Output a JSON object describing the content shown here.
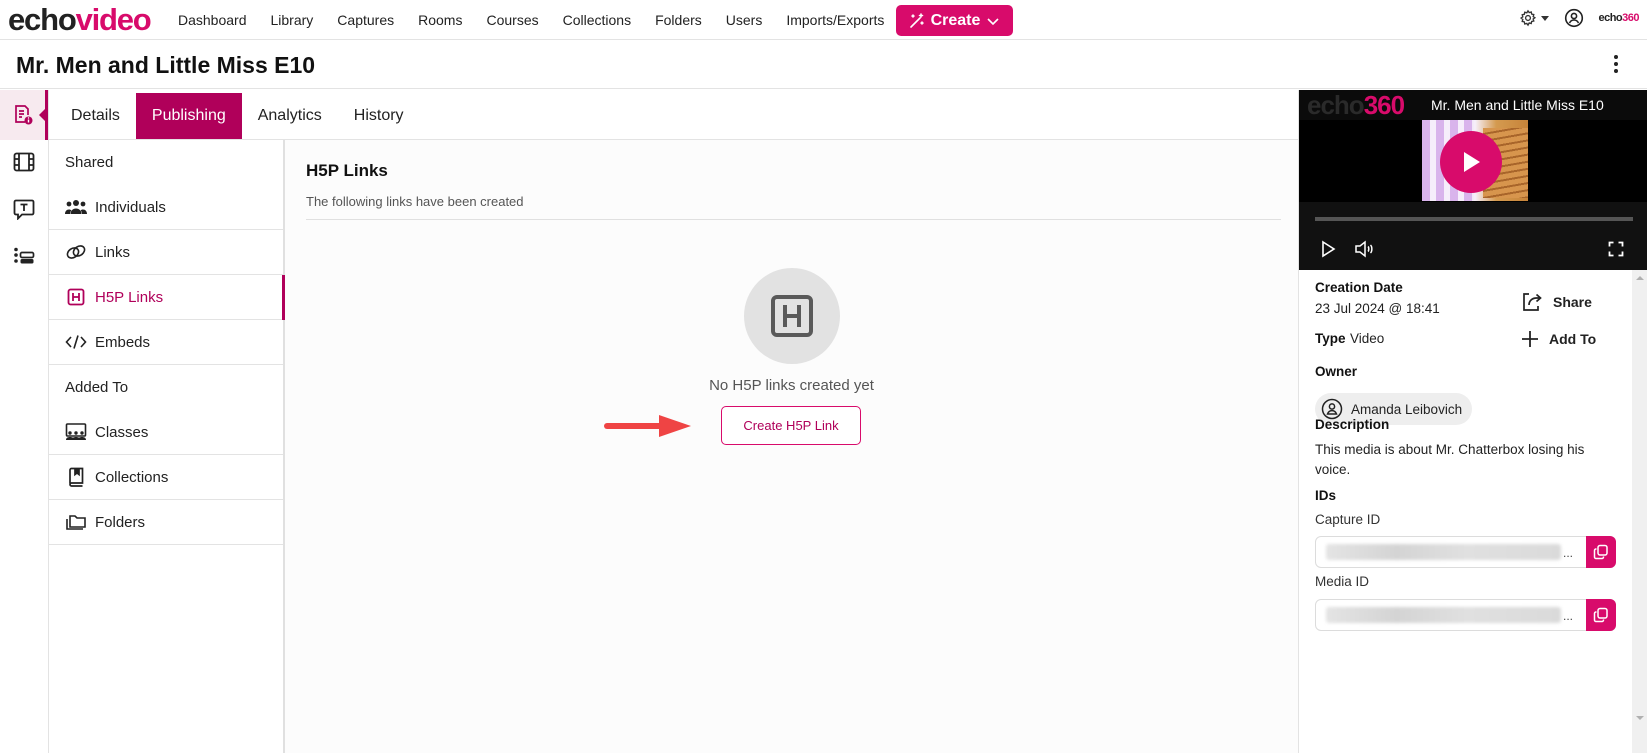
{
  "brand": {
    "logo_part1": "echo",
    "logo_part2": "video",
    "accent": "#d80b6b",
    "accent_dark": "#b0005a",
    "small_logo_part1": "echo",
    "small_logo_part2": "360"
  },
  "nav": {
    "items": [
      "Dashboard",
      "Library",
      "Captures",
      "Rooms",
      "Courses",
      "Collections",
      "Folders",
      "Users",
      "Imports/Exports"
    ],
    "create_label": "Create"
  },
  "page": {
    "title": "Mr. Men and Little Miss E10"
  },
  "rail": {
    "icons": [
      "media-details-icon",
      "film-icon",
      "transcript-icon",
      "list-icon"
    ],
    "active": 0
  },
  "tabs": {
    "items": [
      "Details",
      "Publishing",
      "Analytics",
      "History"
    ],
    "active": "Publishing"
  },
  "subnav": {
    "section_shared": "Shared",
    "shared_items": [
      "Individuals",
      "Links",
      "H5P Links",
      "Embeds"
    ],
    "section_added": "Added To",
    "added_items": [
      "Classes",
      "Collections",
      "Folders"
    ],
    "active": "H5P Links"
  },
  "main": {
    "title": "H5P Links",
    "subtitle": "The following links have been created",
    "empty_text": "No H5P links created yet",
    "create_button": "Create H5P Link"
  },
  "player": {
    "logo_part1": "echo",
    "logo_part2": "360",
    "title": "Mr. Men and Little Miss E10",
    "progress": 0
  },
  "details": {
    "creation_date_label": "Creation Date",
    "creation_date": "23 Jul 2024 @ 18:41",
    "type_label": "Type",
    "type_value": "Video",
    "share_label": "Share",
    "add_to_label": "Add To",
    "owner_label": "Owner",
    "owner_name": "Amanda Leibovich",
    "description_label": "Description",
    "description": "This media is about Mr. Chatterbox losing his voice.",
    "ids_label": "IDs",
    "capture_id_label": "Capture ID",
    "media_id_label": "Media ID",
    "ellipsis": "..."
  }
}
